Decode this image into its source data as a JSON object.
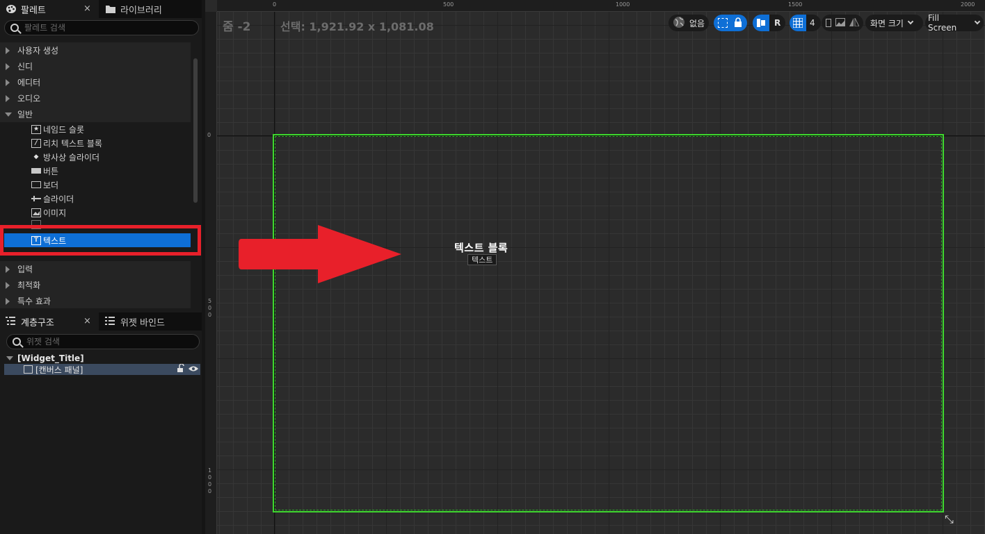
{
  "palette_panel": {
    "tabs": [
      {
        "label": "팔레트",
        "active": true
      },
      {
        "label": "라이브러리",
        "active": false
      }
    ],
    "close_glyph": "×",
    "search": {
      "placeholder": "팔레트 검색"
    },
    "categories_top": [
      {
        "label": "사용자 생성"
      },
      {
        "label": "신디"
      },
      {
        "label": "에디터"
      },
      {
        "label": "오디오"
      },
      {
        "label": "일반"
      }
    ],
    "general_items": [
      {
        "label": "네임드 슬롯",
        "icon": "named-slot-icon"
      },
      {
        "label": "리치 텍스트 블록",
        "icon": "rich-text-icon"
      },
      {
        "label": "방사상 슬라이더",
        "icon": "radial-slider-icon"
      },
      {
        "label": "버튼",
        "icon": "button-icon"
      },
      {
        "label": "보더",
        "icon": "border-icon"
      },
      {
        "label": "슬라이더",
        "icon": "slider-icon"
      },
      {
        "label": "이미지",
        "icon": "image-icon"
      },
      {
        "label": "텍스트",
        "icon": "text-icon",
        "selected": true
      }
    ],
    "categories_bottom": [
      {
        "label": "입력"
      },
      {
        "label": "최적화"
      },
      {
        "label": "특수 효과"
      }
    ]
  },
  "hierarchy_panel": {
    "tabs": [
      {
        "label": "계층구조",
        "active": true
      },
      {
        "label": "위젯 바인드",
        "active": false
      }
    ],
    "close_glyph": "×",
    "search": {
      "placeholder": "위젯 검색"
    },
    "root": "[Widget_Title]",
    "child": "[캔버스 패널]"
  },
  "viewport": {
    "zoom_label": "줌 -2",
    "selection_label": "선택: 1,921.92 x 1,081.08",
    "ruler_top_ticks": [
      "0",
      "500",
      "1000",
      "1500",
      "2000"
    ],
    "ruler_left_ticks": [
      "0",
      "5\n0\n0",
      "1\n0\n0\n0"
    ],
    "text_block_label": "텍스트 블록",
    "text_tooltip": "텍스트",
    "toolbar": {
      "localization": "없음",
      "r_label": "R",
      "grid_snap": "4",
      "screen_size": "화면 크기",
      "fill_screen": "Fill Screen"
    }
  },
  "colors": {
    "selection_blue": "#0e6fd6",
    "highlight_red": "#e8202a",
    "canvas_green": "#3ed82e"
  }
}
